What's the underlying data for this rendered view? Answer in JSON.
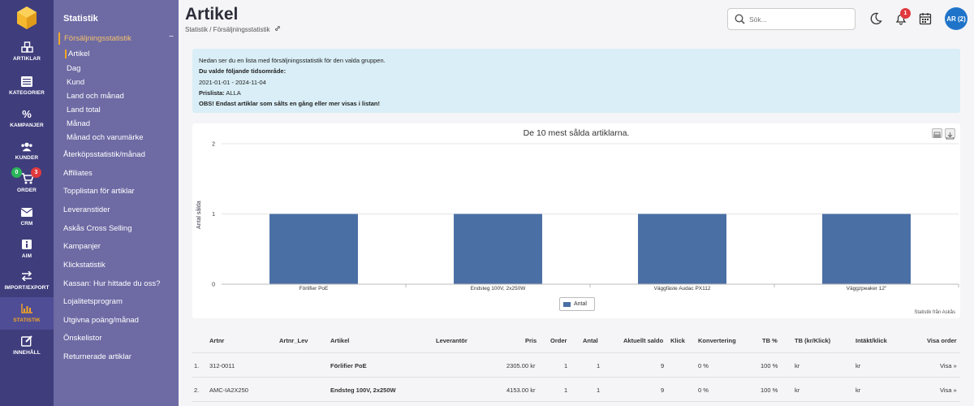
{
  "rail": {
    "items": [
      {
        "label": "ARTIKLAR",
        "icon": "boxes-icon"
      },
      {
        "label": "KATEGORIER",
        "icon": "list-icon"
      },
      {
        "label": "KAMPANJER",
        "icon": "percent-icon"
      },
      {
        "label": "KUNDER",
        "icon": "users-icon"
      },
      {
        "label": "ORDER",
        "icon": "cart-icon"
      },
      {
        "label": "CRM",
        "icon": "mail-icon"
      },
      {
        "label": "AIM",
        "icon": "info-icon"
      },
      {
        "label": "IMPORT/EXPORT",
        "icon": "arrows-icon"
      },
      {
        "label": "STATISTIK",
        "icon": "bar-chart-icon"
      },
      {
        "label": "INNEHÅLL",
        "icon": "edit-icon"
      }
    ],
    "order_badge_green": "0",
    "order_badge_red": "3"
  },
  "sidebar": {
    "title": "Statistik",
    "group": "Försäljningsstatistik",
    "collapse": "−",
    "sub_items": [
      "Artikel",
      "Dag",
      "Kund",
      "Land och månad",
      "Land total",
      "Månad",
      "Månad och varumärke"
    ],
    "menu_items": [
      "Återköpsstatistik/månad",
      "Affiliates",
      "Topplistan för artiklar",
      "Leveranstider",
      "Askås Cross Selling",
      "Kampanjer",
      "Klickstatistik",
      "Kassan: Hur hittade du oss?",
      "Lojalitetsprogram",
      "Utgivna poäng/månad",
      "Önskelistor",
      "Returnerade artiklar"
    ]
  },
  "header": {
    "title": "Artikel",
    "breadcrumb": "Statistik / Försäljningsstatistik",
    "search_placeholder": "Sök...",
    "notification_count": "1",
    "avatar": "AR (2)"
  },
  "info": {
    "line1": "Nedan ser du en lista med försäljningsstatistik för den valda gruppen.",
    "line2": "Du valde följande tidsområde:",
    "line3": "2021-01-01 - 2024-11-04",
    "line4_label": "Prislista:",
    "line4_value": "ALLA",
    "line5": "OBS! Endast artiklar som sålts en gång eller mer visas i listan!"
  },
  "chart_data": {
    "type": "bar",
    "title": "De 10 mest sålda artiklarna.",
    "ylabel": "Antal sålda",
    "categories": [
      "Förlifier PoE",
      "Endsteg 100V, 2x250W",
      "Väggfäste Audac PX112",
      "Väggzpeaker 12\""
    ],
    "series": [
      {
        "name": "Antal",
        "values": [
          1,
          1,
          1,
          1
        ]
      }
    ],
    "ylim": [
      0,
      2
    ],
    "yticks": [
      "0",
      "1",
      "2"
    ],
    "grid": true,
    "legend": "bottom",
    "credit": "Statistik från Askås",
    "color": "#4a6fa5"
  },
  "table": {
    "columns": [
      "Artnr",
      "Artnr_Lev",
      "Artikel",
      "Leverantör",
      "Pris",
      "Order",
      "Antal",
      "Aktuellt saldo",
      "Klick",
      "Konvertering",
      "TB %",
      "TB (kr/Klick)",
      "Intäkt/klick",
      "Visa order"
    ],
    "rows": [
      {
        "num": "1.",
        "artnr": "312-0011",
        "artnr_lev": "",
        "artikel": "Förlifier PoE",
        "leverantor": "",
        "pris": "2305.00 kr",
        "order": "1",
        "antal": "1",
        "saldo": "9",
        "klick": "",
        "konv": "0 %",
        "tb": "100 %",
        "tbkr": "kr",
        "intakt": "kr",
        "visa": "Visa »"
      },
      {
        "num": "2.",
        "artnr": "AMC-IA2X250",
        "artnr_lev": "",
        "artikel": "Endsteg 100V, 2x250W",
        "leverantor": "",
        "pris": "4153.00 kr",
        "order": "1",
        "antal": "1",
        "saldo": "9",
        "klick": "",
        "konv": "0 %",
        "tb": "100 %",
        "tbkr": "kr",
        "intakt": "kr",
        "visa": "Visa »"
      }
    ]
  }
}
